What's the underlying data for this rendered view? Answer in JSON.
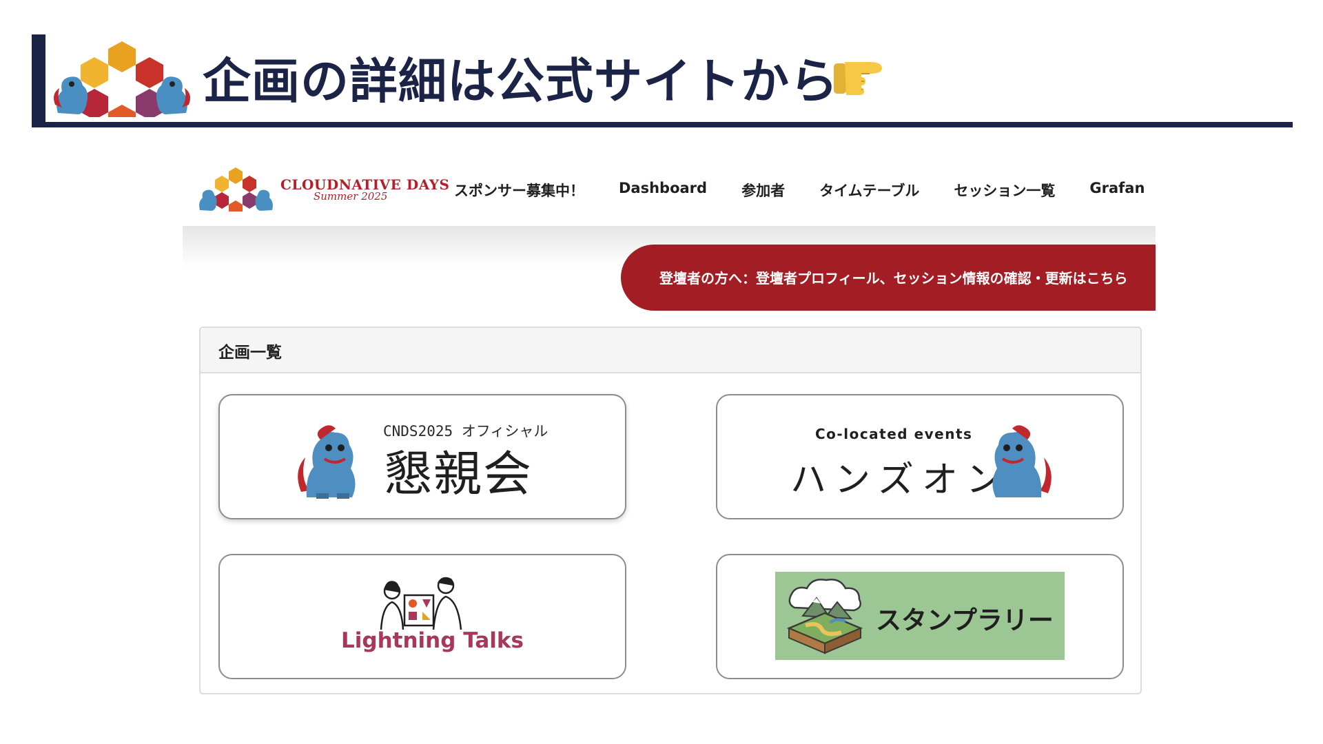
{
  "slide": {
    "title": "企画の詳細は公式サイトから",
    "pointer_icon": "backhand-index-pointing-right-icon",
    "colors": {
      "navy": "#1b2447",
      "accent_red": "#a31e24"
    }
  },
  "site": {
    "brand_main": "CLOUDNATIVE DAYS",
    "brand_sub": "Summer 2025",
    "nav": [
      "スポンサー募集中！",
      "Dashboard",
      "参加者",
      "タイムテーブル",
      "セッション一覧",
      "Grafan"
    ],
    "notice": "登壇者の方へ：登壇者プロフィール、セッション情報の確認・更新はこちら",
    "panel_title": "企画一覧",
    "cards": {
      "konshinkai": {
        "sub": "CNDS2025 オフィシャル",
        "main": "懇親会"
      },
      "handson": {
        "sub": "Co-located events",
        "main": "ハンズオン"
      },
      "lightning": {
        "label": "Lightning Talks"
      },
      "stamp": {
        "label": "スタンプラリー"
      }
    }
  }
}
